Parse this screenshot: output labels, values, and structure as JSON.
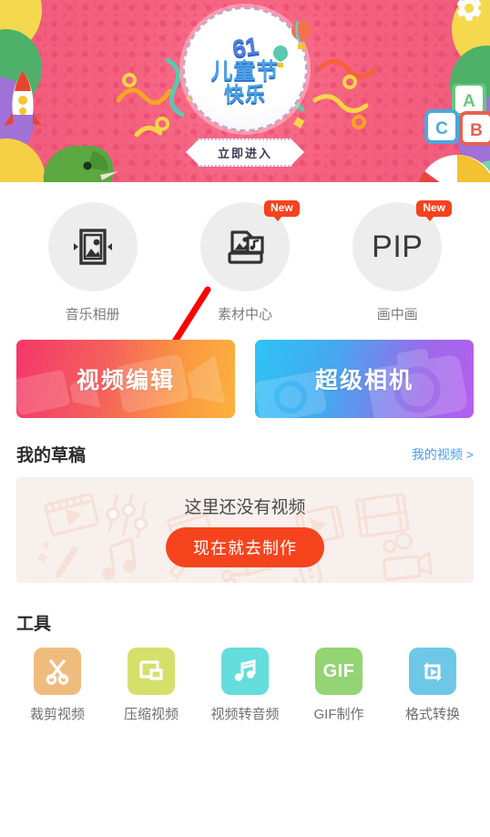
{
  "banner": {
    "logo_number": "61",
    "logo_line1": "儿童节",
    "logo_line2": "快乐",
    "enter_label": "立即进入",
    "gear_icon": "gear-icon",
    "background_color": "#ef5c7e"
  },
  "features": [
    {
      "label": "音乐相册",
      "icon": "photo-album-icon",
      "badge": ""
    },
    {
      "label": "素材中心",
      "icon": "material-center-icon",
      "badge": "New"
    },
    {
      "label": "画中画",
      "icon": "pip-icon",
      "icon_text": "PIP",
      "badge": "New"
    }
  ],
  "actions": [
    {
      "label": "视频编辑",
      "gradient_from": "#f4386a",
      "gradient_to": "#fdb040"
    },
    {
      "label": "超级相机",
      "gradient_from": "#2fc3f5",
      "gradient_to": "#b45ff0"
    }
  ],
  "drafts": {
    "title": "我的草稿",
    "more_link": "我的视频 >",
    "empty_text": "这里还没有视频",
    "cta_label": "现在就去制作",
    "cta_color": "#f5441d"
  },
  "tools": {
    "title": "工具",
    "items": [
      {
        "label": "裁剪视频",
        "icon": "scissors-icon",
        "color": "#f0bc7e"
      },
      {
        "label": "压缩视频",
        "icon": "compress-icon",
        "color": "#d4e06a"
      },
      {
        "label": "视频转音频",
        "icon": "music-note-icon",
        "color": "#64dddd"
      },
      {
        "label": "GIF制作",
        "icon": "gif-icon",
        "icon_text": "GIF",
        "color": "#94d475"
      },
      {
        "label": "格式转换",
        "icon": "convert-loop-icon",
        "color": "#6fc7e8"
      }
    ]
  },
  "annotation": {
    "arrow": "red-arrow-pointing-to-video-edit",
    "color": "#ff0000"
  }
}
